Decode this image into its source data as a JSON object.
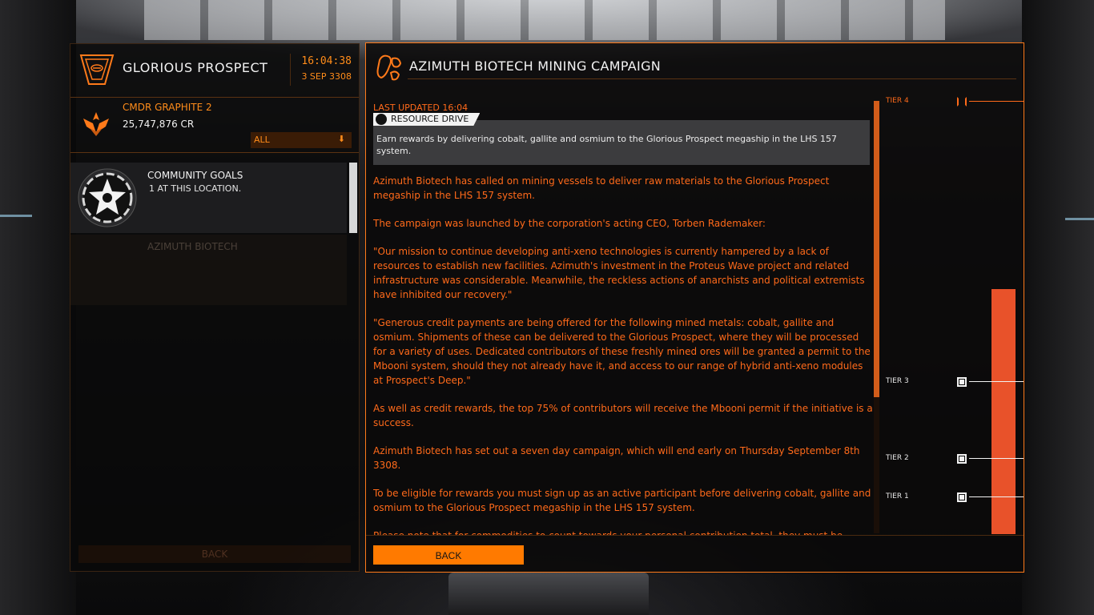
{
  "station": {
    "name": "GLORIOUS PROSPECT",
    "time": "16:04:38",
    "date": "3 SEP 3308"
  },
  "commander": {
    "name": "CMDR GRAPHITE 2",
    "credits": "25,747,876 CR"
  },
  "filter": {
    "label": "ALL",
    "arrow": "⬇"
  },
  "community_goals": {
    "title": "COMMUNITY GOALS",
    "subtitle": "1 AT THIS LOCATION."
  },
  "ghost_item": {
    "label": "AZIMUTH BIOTECH"
  },
  "left_back_label": "BACK",
  "goal": {
    "title": "AZIMUTH BIOTECH MINING CAMPAIGN",
    "last_updated": "LAST UPDATED 16:04",
    "type": "RESOURCE DRIVE",
    "summary": "Earn rewards by delivering cobalt, gallite and osmium to the Glorious Prospect megaship in the LHS 157 system.",
    "paragraphs": [
      "Azimuth Biotech has called on mining vessels to deliver raw materials to the Glorious Prospect megaship in the LHS 157 system.",
      "The campaign was launched by the corporation's acting CEO, Torben Rademaker:",
      "\"Our mission to continue developing anti-xeno technologies is currently hampered by a lack of resources to establish new facilities. Azimuth's investment in the Proteus Wave project and related infrastructure was considerable. Meanwhile, the reckless actions of anarchists and political extremists have inhibited our recovery.\"",
      "\"Generous credit payments are being offered for the following mined metals: cobalt, gallite and osmium. Shipments of these can be delivered to the Glorious Prospect, where they will be processed for a variety of uses. Dedicated contributors of these freshly mined ores will be granted a permit to the Mbooni system, should they not already have it, and access to our range of hybrid anti-xeno modules at Prospect's Deep.\"",
      "As well as credit rewards, the top 75% of contributors will receive the Mbooni permit if the initiative is a success.",
      "Azimuth Biotech has set out a seven day campaign, which will end early on Thursday September 8th 3308.",
      "To be eligible for rewards you must sign up as an active participant before delivering cobalt, gallite and osmium to the Glorious Prospect megaship in the LHS 157 system.",
      "Please note that for commodities to count towards your personal contribution total, they must be"
    ]
  },
  "tiers": {
    "tier4": "TIER 4",
    "tier3": "TIER 3",
    "tier2": "TIER 2",
    "tier1": "TIER 1"
  },
  "progress_fraction": 0.88,
  "back_label": "BACK",
  "colors": {
    "accent": "#ff7a00",
    "text_orange": "#ff6a1a",
    "progress": "#e8522a",
    "panel": "#0a0909"
  }
}
